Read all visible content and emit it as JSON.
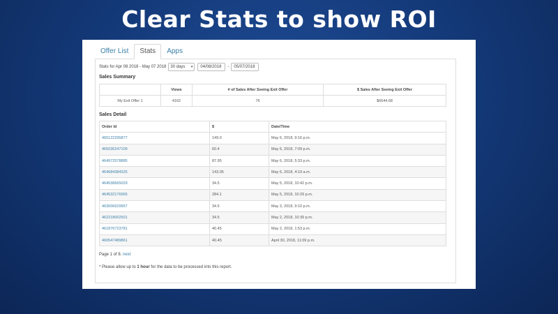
{
  "slide": {
    "title": "Clear Stats to show ROI"
  },
  "tabs": [
    {
      "label": "Offer List"
    },
    {
      "label": "Stats"
    },
    {
      "label": "Apps"
    }
  ],
  "filters": {
    "range_label": "Stats for Apr 08 2018 - May 07 2018",
    "period_value": "30 days",
    "start_date": "04/08/2018",
    "separator": "-",
    "end_date": "05/07/2018"
  },
  "summary": {
    "title": "Sales Summary",
    "headers": [
      "",
      "Views",
      "# of Sales After Seeing Exit Offer",
      "$ Sales After Seeing Exit Offer"
    ],
    "row": [
      "My Exit Offer 1",
      "4162",
      "76",
      "$6644.68"
    ]
  },
  "detail": {
    "title": "Sales Detail",
    "headers": [
      "Order Id",
      "$",
      "Date/Time"
    ],
    "rows": [
      [
        "465122295877",
        "149.0",
        "May 6, 2018, 9:16 p.m."
      ],
      [
        "465036247109",
        "60.4",
        "May 6, 2018, 7:09 p.m."
      ],
      [
        "464972578885",
        "87.95",
        "May 6, 2018, 5:33 p.m."
      ],
      [
        "464684384325",
        "143.05",
        "May 6, 2018, 4:19 a.m."
      ],
      [
        "464538665029",
        "34.5",
        "May 5, 2018, 10:42 p.m."
      ],
      [
        "464532176965",
        "284.1",
        "May 5, 2018, 10:29 p.m."
      ],
      [
        "463006629957",
        "34.5",
        "May 3, 2018, 9:10 p.m."
      ],
      [
        "462218002501",
        "34.5",
        "May 2, 2018, 10:39 p.m."
      ],
      [
        "461876723781",
        "40.45",
        "May 2, 2018, 1:53 p.m."
      ],
      [
        "460547489861",
        "40.45",
        "April 30, 2018, 11:09 p.m."
      ]
    ]
  },
  "pagination": {
    "text": "Page 1 of 8.",
    "next_label": "next"
  },
  "note": {
    "prefix": "* Please allow up to ",
    "emphasis": "1 hour",
    "suffix": " for the data to be processed into this report."
  }
}
